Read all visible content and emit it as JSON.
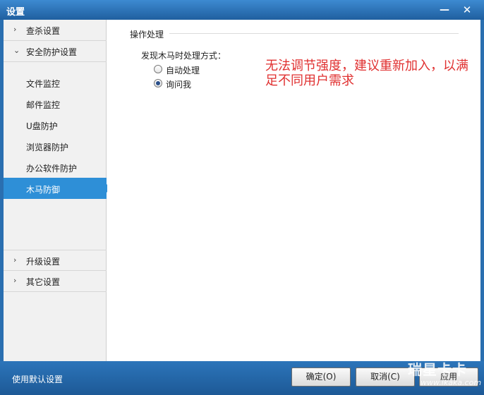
{
  "window": {
    "title": "设置",
    "minimize_label": "—",
    "close_label": "✕"
  },
  "sidebar": {
    "groups": [
      {
        "label": "查杀设置",
        "expanded": false,
        "icon": "chevron-right-icon"
      },
      {
        "label": "安全防护设置",
        "expanded": true,
        "icon": "chevron-down-icon"
      },
      {
        "label": "升级设置",
        "expanded": false,
        "icon": "chevron-right-icon"
      },
      {
        "label": "其它设置",
        "expanded": false,
        "icon": "chevron-right-icon"
      }
    ],
    "items": [
      {
        "label": "文件监控",
        "active": false
      },
      {
        "label": "邮件监控",
        "active": false
      },
      {
        "label": "U盘防护",
        "active": false
      },
      {
        "label": "浏览器防护",
        "active": false
      },
      {
        "label": "办公软件防护",
        "active": false
      },
      {
        "label": "木马防御",
        "active": true
      }
    ]
  },
  "content": {
    "section_title": "操作处理",
    "question": "发现木马时处理方式：",
    "options": [
      {
        "label": "自动处理",
        "checked": false
      },
      {
        "label": "询问我",
        "checked": true
      }
    ],
    "annotation": "无法调节强度，建议重新加入，以满足不同用户需求"
  },
  "footer": {
    "default_link": "使用默认设置",
    "ok_label": "确定(O)",
    "cancel_label": "取消(C)",
    "apply_label": "应用"
  },
  "watermark": {
    "brand": "瑞星卡卡",
    "url": "www.ikaka.com"
  },
  "colors": {
    "accent": "#2e8fd7",
    "titlebar": "#2a6fb0",
    "annotation": "#e03030"
  }
}
